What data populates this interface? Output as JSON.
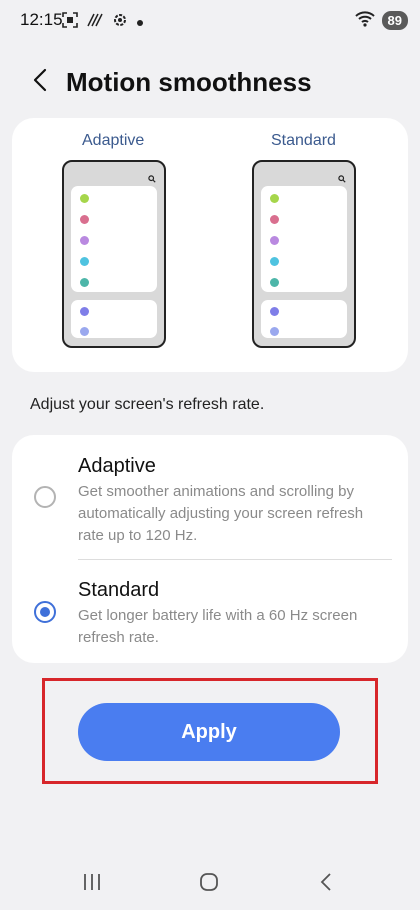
{
  "status_bar": {
    "time": "12:15",
    "battery": "89",
    "icons": [
      "screenshot-icon",
      "nfc-icon",
      "settings-icon",
      "notification-dot-icon",
      "wifi-icon"
    ]
  },
  "header": {
    "title": "Motion smoothness",
    "back_icon": "back-arrow-icon"
  },
  "preview": {
    "left_label": "Adaptive",
    "right_label": "Standard",
    "dot_colors": [
      "#a6d64b",
      "#d96f8f",
      "#b989e0",
      "#4fc3e0",
      "#4db6a9",
      "#7f7ee8",
      "#9aa8ee"
    ]
  },
  "subtitle": "Adjust your screen's refresh rate.",
  "options": [
    {
      "title": "Adaptive",
      "description": "Get smoother animations and scrolling by automatically adjusting your screen refresh rate up to 120 Hz.",
      "selected": false
    },
    {
      "title": "Standard",
      "description": "Get longer battery life with a 60 Hz screen refresh rate.",
      "selected": true
    }
  ],
  "apply_label": "Apply",
  "colors": {
    "accent": "#4a7df0",
    "radio": "#3f70d9",
    "highlight": "#d7262a"
  },
  "nav": {
    "recents_icon": "recents-icon",
    "home_icon": "home-icon",
    "back_icon": "nav-back-icon"
  }
}
